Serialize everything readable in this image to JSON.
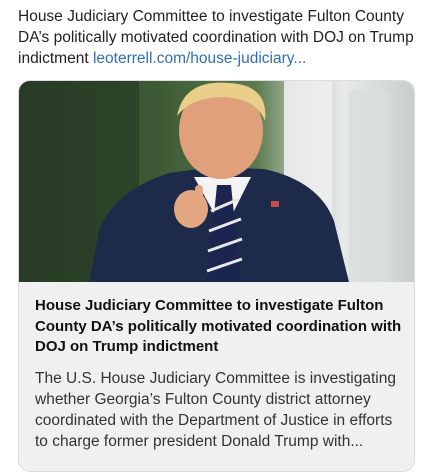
{
  "post": {
    "text": "House Judiciary Committee to investigate Fulton County DA’s politically motivated coordination with DOJ on Trump indictment ",
    "link": "leoterrell.com/house-judiciary..."
  },
  "card": {
    "image_alt": "Donald Trump pointing at the camera",
    "title": "House Judiciary Committee to investigate Fulton County DA’s politically motivated coordination with DOJ on Trump indictment",
    "description": "The U.S. House Judiciary Committee is investigating whether Georgia’s Fulton County district attorney coordinated with the Department of Justice in efforts to charge former president Donald Trump with..."
  }
}
